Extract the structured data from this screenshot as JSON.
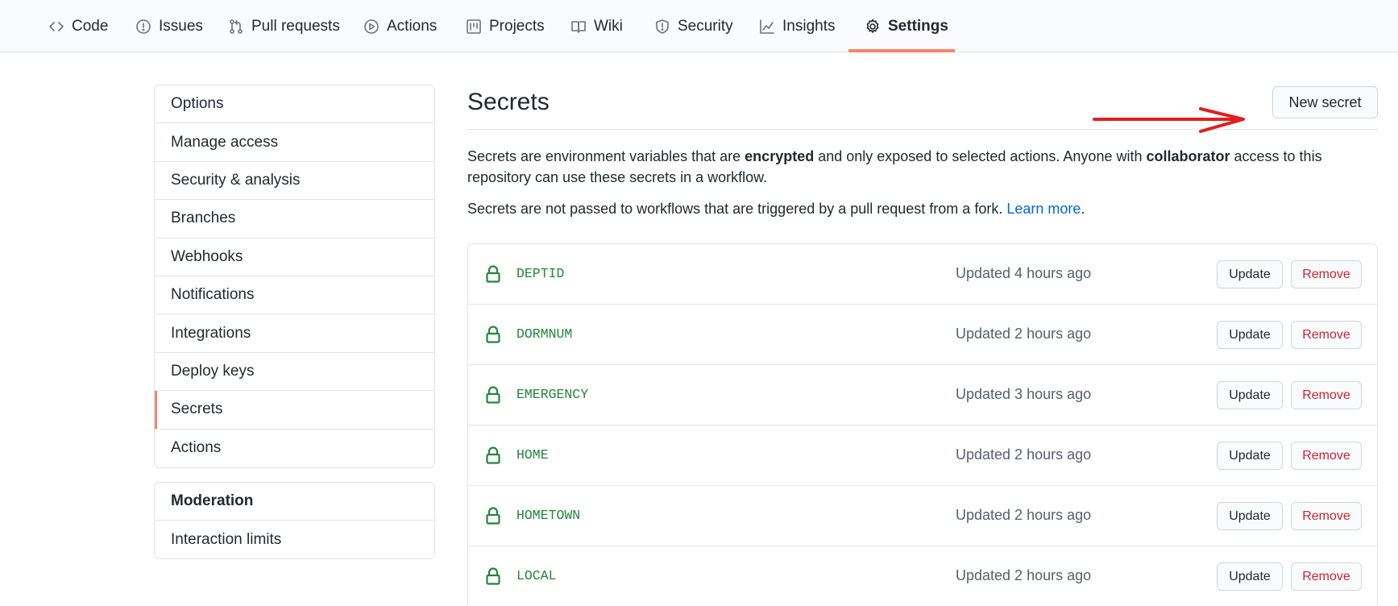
{
  "tabs": [
    {
      "label": "Code",
      "icon": "code-icon"
    },
    {
      "label": "Issues",
      "icon": "issue-opened-icon"
    },
    {
      "label": "Pull requests",
      "icon": "git-pull-request-icon"
    },
    {
      "label": "Actions",
      "icon": "play-icon"
    },
    {
      "label": "Projects",
      "icon": "project-icon"
    },
    {
      "label": "Wiki",
      "icon": "book-icon"
    },
    {
      "label": "Security",
      "icon": "shield-icon"
    },
    {
      "label": "Insights",
      "icon": "graph-icon"
    },
    {
      "label": "Settings",
      "icon": "gear-icon",
      "active": true
    }
  ],
  "sidebar": {
    "items": [
      {
        "label": "Options"
      },
      {
        "label": "Manage access"
      },
      {
        "label": "Security & analysis"
      },
      {
        "label": "Branches"
      },
      {
        "label": "Webhooks"
      },
      {
        "label": "Notifications"
      },
      {
        "label": "Integrations"
      },
      {
        "label": "Deploy keys"
      },
      {
        "label": "Secrets",
        "selected": true
      },
      {
        "label": "Actions"
      }
    ],
    "moderation": {
      "heading": "Moderation",
      "items": [
        {
          "label": "Interaction limits"
        }
      ]
    }
  },
  "main": {
    "title": "Secrets",
    "new_button": "New secret",
    "desc1": {
      "part1": "Secrets are environment variables that are ",
      "bold1": "encrypted",
      "part2": " and only exposed to selected actions. Anyone with ",
      "bold2": "collaborator",
      "part3": " access to this repository can use these secrets in a workflow."
    },
    "desc2": {
      "text": "Secrets are not passed to workflows that are triggered by a pull request from a fork. ",
      "link": "Learn more",
      "end": "."
    }
  },
  "secrets": [
    {
      "name": "DEPTID",
      "updated": "Updated 4 hours ago"
    },
    {
      "name": "DORMNUM",
      "updated": "Updated 2 hours ago"
    },
    {
      "name": "EMERGENCY",
      "updated": "Updated 3 hours ago"
    },
    {
      "name": "HOME",
      "updated": "Updated 2 hours ago"
    },
    {
      "name": "HOMETOWN",
      "updated": "Updated 2 hours ago"
    },
    {
      "name": "LOCAL",
      "updated": "Updated 2 hours ago"
    }
  ],
  "row_buttons": {
    "update": "Update",
    "remove": "Remove"
  },
  "colors": {
    "accent": "#f9826c",
    "secret_green": "#22863a",
    "danger": "#cb2431",
    "link": "#0366d6",
    "annotation_arrow": "#e02020"
  }
}
